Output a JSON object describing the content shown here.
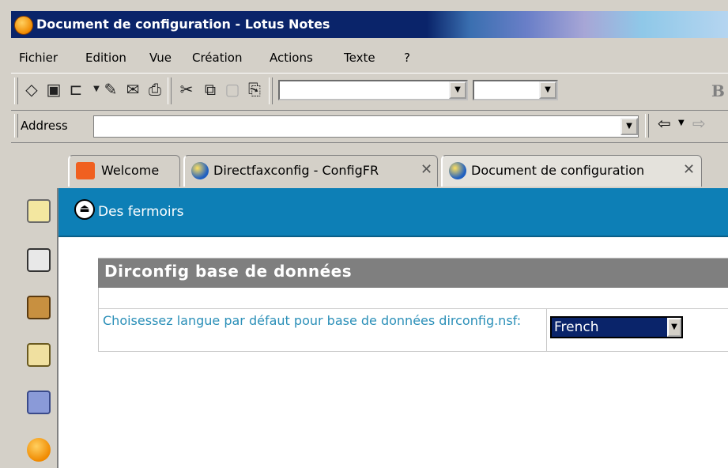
{
  "window": {
    "title": "Document de configuration - Lotus Notes"
  },
  "menu": [
    "Fichier",
    "Edition",
    "Vue",
    "Création",
    "Actions",
    "Texte",
    "?"
  ],
  "toolbar": {
    "font_combo_value": "",
    "size_combo_value": "",
    "bold_label": "B"
  },
  "address": {
    "label": "Address",
    "value": ""
  },
  "tabs": [
    {
      "label": "Welcome"
    },
    {
      "label": "Directfaxconfig - ConfigFR"
    },
    {
      "label": "Document de configuration"
    }
  ],
  "action_bar": {
    "label": "Des fermoirs"
  },
  "form": {
    "title": "Dirconfig base de données",
    "field_label": "Choisessez langue par défaut pour base de données dirconfig.nsf:",
    "field_value": "French"
  },
  "colors": {
    "action_bar": "#0d7fb6",
    "form_header": "#7f7f7f",
    "field_label": "#2a8fb8",
    "selection": "#0a246a"
  }
}
